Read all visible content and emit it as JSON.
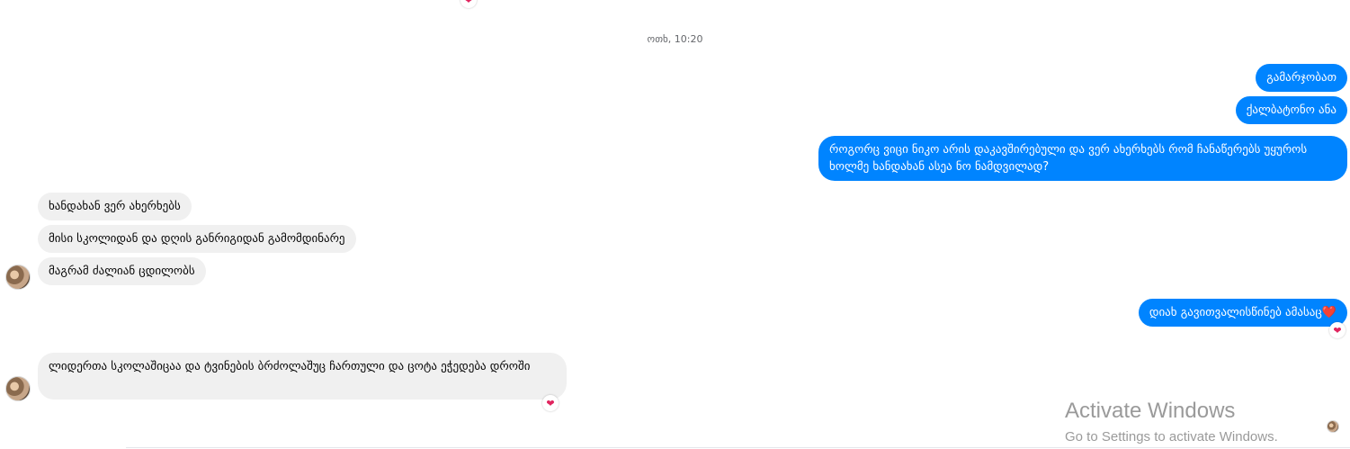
{
  "conversation": {
    "timestamp": "ოთხ, 10:20",
    "outgoing": [
      "გამარჯობათ",
      "ქალბატონო ანა",
      "როგორც ვიცი ნიკო არის დაკავშირებული და ვერ ახერხებს რომ ჩანაწერებს უყუროს ხოლმე ხანდახან ასეა ნო ნამდვილად?",
      "დიახ გავითვალისწინებ ამასაც❤️"
    ],
    "incoming": [
      "ხანდახან ვერ ახერხებს",
      "მისი სკოლიდან და დღის განრიგიდან გამომდინარე",
      "მაგრამ ძალიან ცდილობს",
      "ლიდერთა სკოლაშიცაა და ტვინების ბრძოლაშუც ჩართული და ცოტა ეჭედება დროში"
    ],
    "reaction_emoji": "❤"
  },
  "watermark": {
    "title": "Activate Windows",
    "subtitle": "Go to Settings to activate Windows."
  },
  "colors": {
    "outgoing_bubble": "#0084ff",
    "incoming_bubble": "#f0f0f0",
    "reaction": "#e0245e"
  }
}
